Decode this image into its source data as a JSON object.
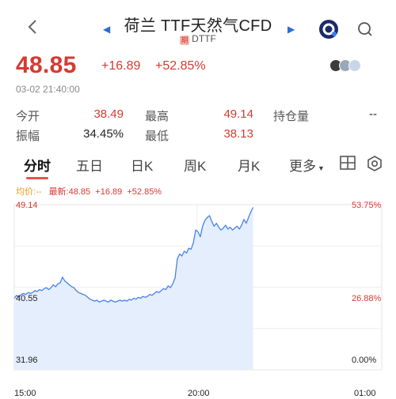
{
  "header": {
    "title": "荷兰 TTF天然气CFD",
    "badge": "期",
    "subtitle": "DTTF",
    "prev_icon": "triangle-left-icon",
    "next_icon": "triangle-right-icon"
  },
  "quote": {
    "price": "48.85",
    "change": "+16.89",
    "change_pct": "+52.85%",
    "time": "03-02 21:40:00"
  },
  "stats": [
    {
      "label": "今开",
      "value": "38.49"
    },
    {
      "label": "最高",
      "value": "49.14"
    },
    {
      "label": "持仓量",
      "value": "--"
    },
    {
      "label": "振幅",
      "value": "34.45%"
    },
    {
      "label": "最低",
      "value": "38.13"
    }
  ],
  "tabs": [
    "分时",
    "五日",
    "日K",
    "周K",
    "月K",
    "更多"
  ],
  "active_tab": "分时",
  "legend": {
    "avg": "均价:--",
    "latest": "最新:48.85",
    "change": "+16.89",
    "pct": "+52.85%"
  },
  "chart_data": {
    "type": "area",
    "y_left_labels": [
      "49.14",
      "40.55",
      "31.96"
    ],
    "y_right_labels": [
      "53.75%",
      "26.88%",
      "0.00%"
    ],
    "x_labels": [
      "15:00",
      "20:00",
      "01:00"
    ],
    "ylim": [
      31.96,
      49.14
    ],
    "grid": true,
    "x": [
      0,
      3,
      6,
      9,
      12,
      15,
      18,
      21,
      24,
      27,
      30,
      33,
      36,
      39,
      42,
      45,
      48,
      51,
      54,
      57,
      60,
      63,
      66,
      69,
      72,
      75,
      78,
      81,
      84,
      87,
      90,
      93,
      96,
      99,
      102,
      105,
      108,
      111,
      114,
      117,
      120,
      123,
      126,
      129,
      132,
      135,
      138,
      141,
      144,
      147,
      150,
      153,
      156,
      159,
      162,
      165,
      168,
      171,
      174,
      177,
      180,
      183,
      186,
      189,
      192,
      195,
      198,
      201,
      204,
      207,
      210,
      213,
      216,
      219,
      222,
      225,
      228,
      231,
      234,
      237,
      240,
      243,
      246,
      249,
      252,
      255,
      258,
      261,
      264,
      267,
      270,
      273,
      276,
      279,
      282,
      285,
      288,
      291,
      294,
      297,
      300,
      303,
      306,
      309,
      312
    ],
    "values": [
      39.4,
      39.7,
      39.5,
      39.8,
      39.9,
      39.8,
      40.0,
      39.9,
      40.0,
      40.2,
      40.1,
      40.3,
      40.2,
      40.4,
      40.5,
      40.3,
      40.5,
      40.8,
      40.6,
      40.9,
      41.0,
      41.6,
      41.2,
      41.0,
      40.8,
      40.6,
      40.5,
      40.2,
      40.0,
      39.9,
      39.8,
      39.7,
      39.5,
      39.3,
      39.2,
      39.1,
      39.2,
      39.0,
      39.1,
      39.2,
      39.1,
      39.0,
      39.2,
      39.1,
      39.0,
      39.1,
      39.2,
      39.1,
      39.2,
      39.1,
      39.3,
      39.2,
      39.4,
      39.3,
      39.5,
      39.4,
      39.6,
      39.5,
      39.6,
      39.8,
      39.7,
      39.9,
      40.1,
      40.0,
      40.2,
      40.4,
      40.3,
      40.7,
      40.5,
      40.9,
      41.5,
      43.5,
      44.0,
      43.8,
      44.3,
      44.1,
      44.6,
      44.5,
      45.2,
      46.5,
      46.3,
      45.8,
      46.9,
      47.5,
      47.8,
      48.0,
      47.4,
      46.9,
      47.2,
      46.8,
      46.5,
      46.7,
      47.0,
      46.6,
      46.8,
      46.5,
      46.7,
      46.9,
      46.6,
      47.0,
      47.6,
      47.2,
      47.8,
      48.4,
      48.85,
      49.14
    ],
    "line_color": "#4a82e8",
    "fill_color": "#e4eefc"
  },
  "colors": {
    "up": "#d53a32",
    "avg_line": "#e89a1c",
    "accent": "#2a6fd6"
  }
}
